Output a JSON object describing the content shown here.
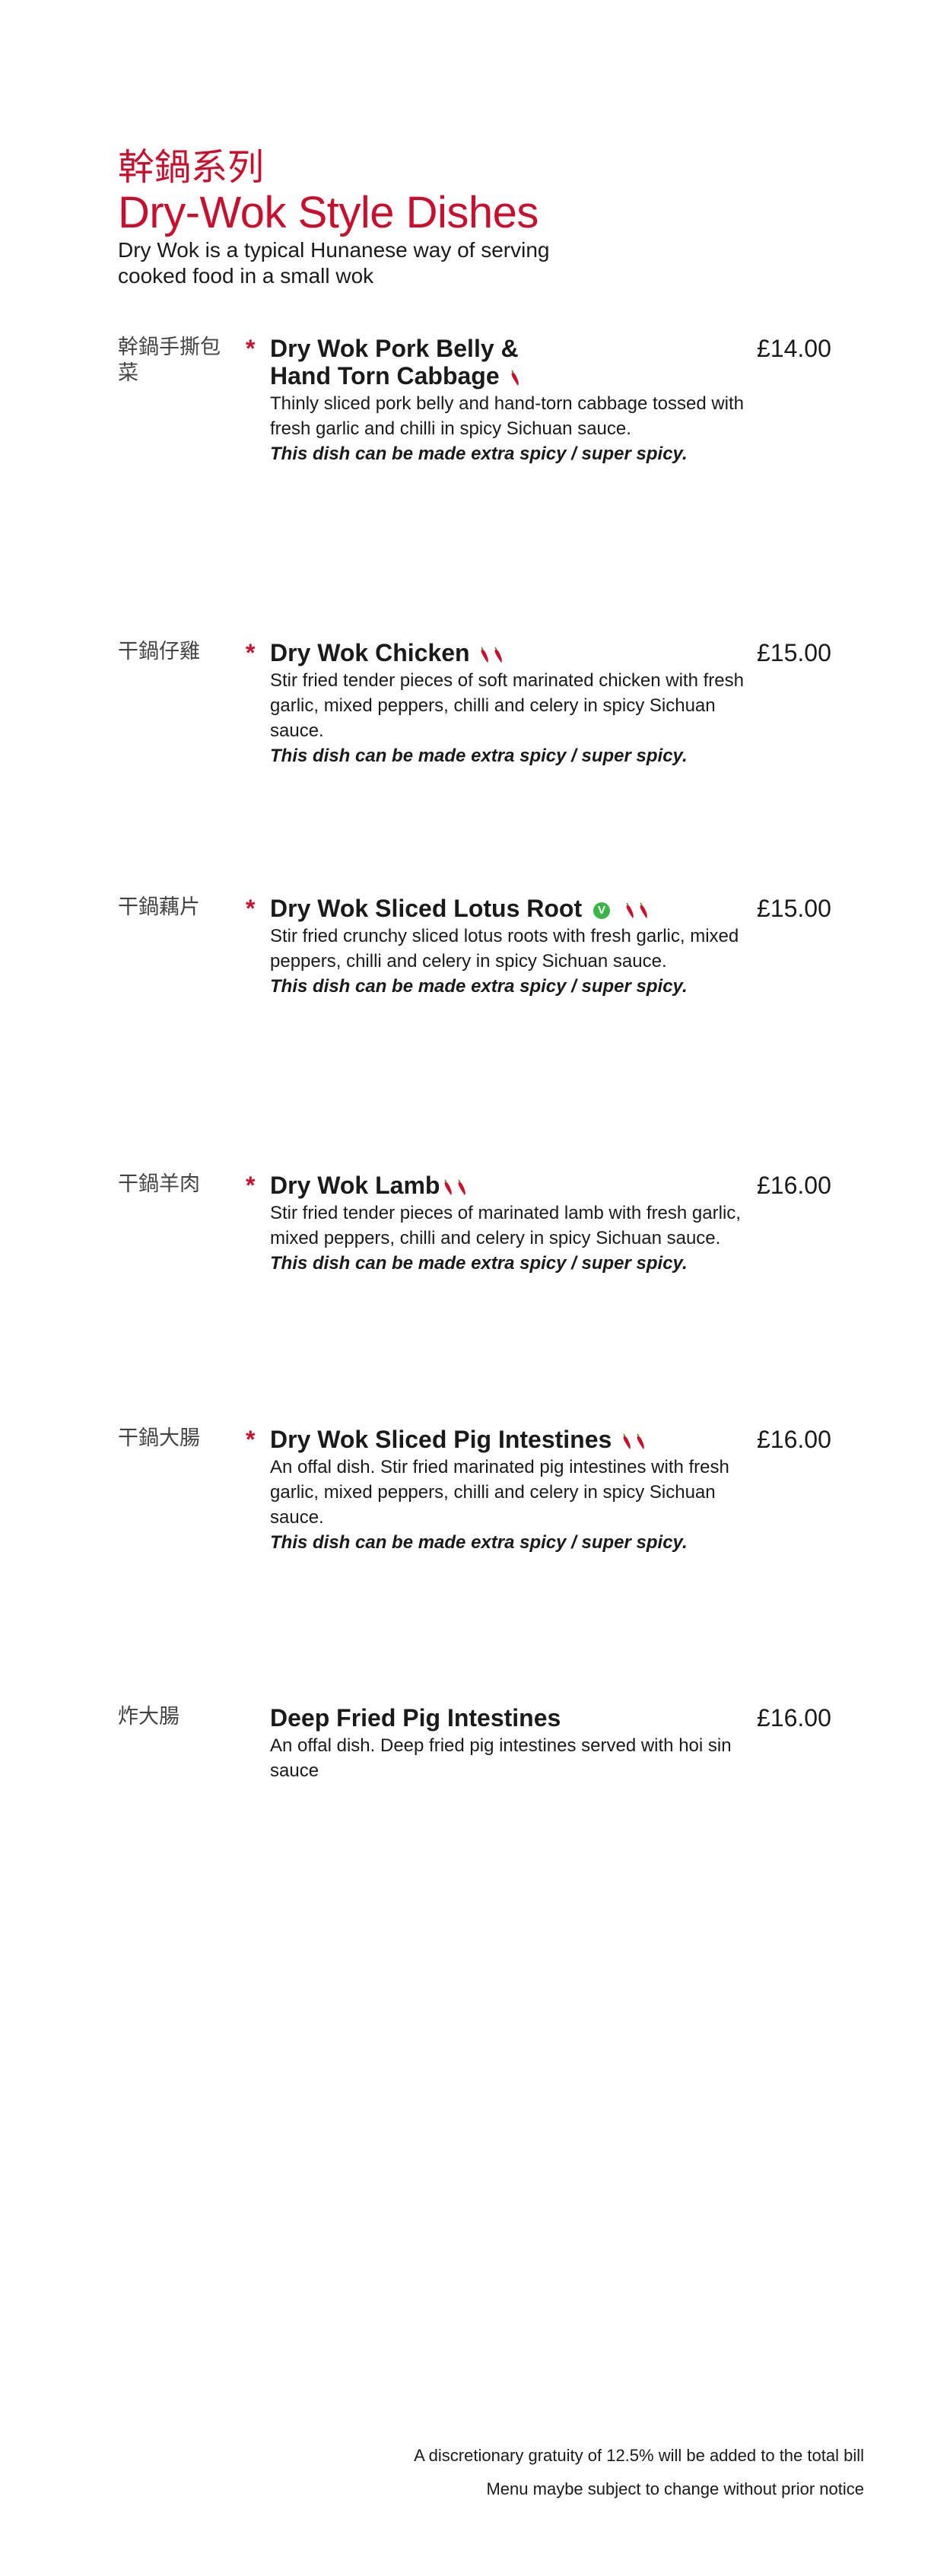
{
  "header": {
    "title_cn": "幹鍋系列",
    "title_en": "Dry-Wok Style Dishes",
    "intro": "Dry Wok is a typical Hunanese way of serving cooked food in a small wok"
  },
  "colors": {
    "accent": "#c8102e",
    "vegetarian": "#3bb54a"
  },
  "dishes": [
    {
      "cn": "幹鍋手撕包菜",
      "star": "*",
      "name_line1": "Dry Wok Pork Belly &",
      "name_line2": "Hand Torn Cabbage",
      "chilli_count": 1,
      "vegetarian": false,
      "desc": "Thinly sliced pork belly and hand-torn cabbage tossed with fresh garlic and chilli in spicy Sichuan sauce.",
      "note": "This dish can be made extra spicy / super spicy.",
      "price": "£14.00"
    },
    {
      "cn": "干鍋仔雞",
      "star": "*",
      "name": "Dry Wok Chicken",
      "chilli_count": 2,
      "vegetarian": false,
      "desc": "Stir fried tender pieces of soft marinated chicken with fresh garlic, mixed peppers, chilli and celery in spicy Sichuan sauce.",
      "note": "This dish can be made extra spicy / super spicy.",
      "price": "£15.00"
    },
    {
      "cn": "干鍋藕片",
      "star": "*",
      "name": "Dry Wok Sliced Lotus Root",
      "chilli_count": 2,
      "vegetarian": true,
      "veg_mark": "V",
      "desc": "Stir fried crunchy sliced lotus roots with fresh garlic, mixed peppers, chilli and celery in spicy Sichuan sauce.",
      "note": "This dish can be made extra spicy / super spicy.",
      "price": "£15.00"
    },
    {
      "cn": "干鍋羊肉",
      "star": "*",
      "name": "Dry Wok Lamb",
      "chilli_count": 2,
      "vegetarian": false,
      "desc": "Stir fried tender pieces of marinated lamb with fresh garlic, mixed peppers, chilli and celery in spicy Sichuan sauce.",
      "note": "This dish can be made extra spicy / super spicy.",
      "price": "£16.00"
    },
    {
      "cn": "干鍋大腸",
      "star": "*",
      "name": "Dry Wok Sliced Pig Intestines",
      "chilli_count": 2,
      "vegetarian": false,
      "desc": "An offal dish. Stir fried marinated pig intestines with fresh garlic, mixed peppers, chilli and celery in spicy Sichuan sauce.",
      "note": "This dish can be made extra spicy / super spicy.",
      "price": "£16.00"
    },
    {
      "cn": "炸大腸",
      "star": "",
      "name": "Deep Fried Pig Intestines",
      "chilli_count": 0,
      "vegetarian": false,
      "desc": "An offal dish. Deep fried pig intestines served with hoi sin sauce",
      "note": "",
      "price": "£16.00"
    }
  ],
  "footer": {
    "gratuity": "A discretionary gratuity of 12.5% will be added to the total bill",
    "notice": "Menu maybe subject to change without prior notice"
  }
}
